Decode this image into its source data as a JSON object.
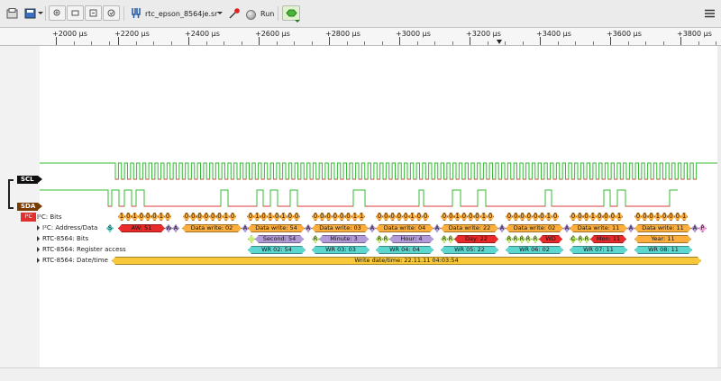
{
  "toolbar": {
    "device_name": "rtc_epson_8564je.sr",
    "run_label": "Run",
    "icons": [
      "open-file-icon",
      "save-icon",
      "zoom-in-icon",
      "zoom-out-icon",
      "zoom-fit-icon",
      "zoom-one-to-one-icon",
      "probe-icon",
      "device-icon",
      "run-icon",
      "decoder-icon",
      "menu-icon"
    ]
  },
  "ruler": {
    "ticks": [
      "+2000 µs",
      "+2200 µs",
      "+2400 µs",
      "+2600 µs",
      "+2800 µs",
      "+3000 µs",
      "+3200 µs",
      "+3400 µs",
      "+3600 µs",
      "+3800 µs"
    ]
  },
  "channels": {
    "scl": "SCL",
    "sda": "SDA"
  },
  "decoder": {
    "badge": "I²C",
    "rows": [
      "I²C: Bits",
      "I²C: Address/Data",
      "RTC-8564: Bits",
      "RTC-8564: Register access",
      "RTC-8564: Date/time"
    ]
  },
  "bits_groups": [
    "10100010",
    "00000010",
    "01010100",
    "00000011",
    "00000100",
    "00100010",
    "00000010",
    "00010001",
    "00010001"
  ],
  "address_data": [
    {
      "k": "S",
      "t": "S"
    },
    {
      "k": "aw",
      "t": "AW: 51"
    },
    {
      "k": "w",
      "t": "W"
    },
    {
      "k": "a",
      "t": "A"
    },
    {
      "k": "dw",
      "t": "Data write: 02"
    },
    {
      "k": "a",
      "t": "A"
    },
    {
      "k": "dw",
      "t": "Data write: 54"
    },
    {
      "k": "a",
      "t": "A"
    },
    {
      "k": "dw",
      "t": "Data write: 03"
    },
    {
      "k": "a",
      "t": "A"
    },
    {
      "k": "dw",
      "t": "Data write: 04"
    },
    {
      "k": "a",
      "t": "A"
    },
    {
      "k": "dw",
      "t": "Data write: 22"
    },
    {
      "k": "a",
      "t": "A"
    },
    {
      "k": "dw",
      "t": "Data write: 02"
    },
    {
      "k": "a",
      "t": "A"
    },
    {
      "k": "dw",
      "t": "Data write: 11"
    },
    {
      "k": "a",
      "t": "A"
    },
    {
      "k": "dw",
      "t": "Data write: 11"
    },
    {
      "k": "a",
      "t": "A"
    },
    {
      "k": "p",
      "t": "P"
    }
  ],
  "rtc_bits": [
    {
      "k": "r",
      "t": ""
    },
    {
      "k": "v",
      "t": "Second: 54"
    },
    {
      "k": "r",
      "t": "R"
    },
    {
      "k": "v",
      "t": "Minute: 3"
    },
    {
      "k": "r",
      "t": "R"
    },
    {
      "k": "r",
      "t": "R"
    },
    {
      "k": "v",
      "t": "Hour: 4"
    },
    {
      "k": "r",
      "t": "R"
    },
    {
      "k": "r",
      "t": "R"
    },
    {
      "k": "vr",
      "t": "Day: 22"
    },
    {
      "k": "r",
      "t": "R"
    },
    {
      "k": "r",
      "t": "R"
    },
    {
      "k": "r",
      "t": "R"
    },
    {
      "k": "r",
      "t": "R"
    },
    {
      "k": "r",
      "t": "R"
    },
    {
      "k": "wd",
      "t": "WD"
    },
    {
      "k": "c",
      "t": "C"
    },
    {
      "k": "r",
      "t": "R"
    },
    {
      "k": "r",
      "t": "R"
    },
    {
      "k": "vr",
      "t": "Mon: 11"
    },
    {
      "k": "yr",
      "t": "Year: 11"
    }
  ],
  "register_access": [
    "WR 02: 54",
    "WR 03: 03",
    "WR 04: 04",
    "WR 05: 22",
    "WR 06: 02",
    "WR 07: 11",
    "WR 08: 11"
  ],
  "datetime": "Write date/time: 22.11.11 04:03:54",
  "colors": {
    "scl_trace": "#33bb33",
    "scl_low": "#d83b3b",
    "sda_trace": "#33bb33",
    "bits": "#fcae3e",
    "address_write": "#e82a2a",
    "ack": "#b39ad8",
    "register": "#5ed6d0",
    "datetime": "#f8c83a"
  }
}
